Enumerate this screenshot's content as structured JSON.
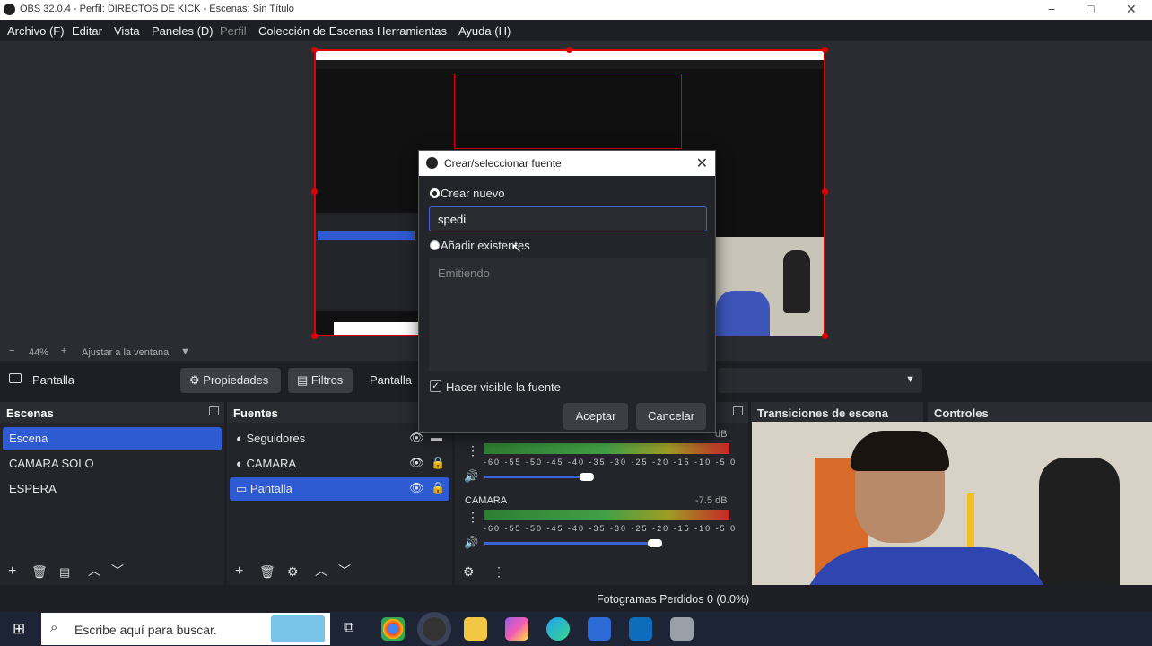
{
  "window": {
    "title": "OBS 32.0.4 - Perfil: DIRECTOS DE KICK - Escenas: Sin Título",
    "minimize": "−",
    "maximize": "□",
    "close": "✕"
  },
  "menu": [
    "Archivo (F)",
    "Editar",
    "Vista",
    "Paneles (D)",
    "Perfil",
    "Colección de Escenas",
    "Herramientas",
    "Ayuda (H)"
  ],
  "zoom": {
    "minus": "−",
    "value": "44%",
    "plus": "+",
    "fit": "Ajustar a la ventana"
  },
  "source_toolbar": {
    "source": "Pantalla",
    "properties": "Propiedades",
    "filters": "Filtros",
    "label": "Pantalla"
  },
  "scenes": {
    "title": "Escenas",
    "items": [
      "Escena",
      "CAMARA SOLO",
      "ESPERA"
    ],
    "selected": 0
  },
  "sources": {
    "title": "Fuentes",
    "items": [
      "Seguidores",
      "CAMARA",
      "Pantalla"
    ],
    "selected": 2
  },
  "mixer": {
    "tracks": [
      {
        "name": "",
        "db": "dB",
        "level": 0.5,
        "volume": 0.88
      },
      {
        "name": "CAMARA",
        "db": "-7.5 dB",
        "level": 0.5,
        "volume": 0.96
      }
    ],
    "scale": [
      "-60",
      "-55",
      "-50",
      "-45",
      "-40",
      "-35",
      "-30",
      "-25",
      "-20",
      "-15",
      "-10",
      "-5",
      "0"
    ]
  },
  "transitions": {
    "title": "Transiciones de escena"
  },
  "controls": {
    "title": "Controles"
  },
  "status": {
    "frames": "Fotogramas Perdidos 0 (0.0%)"
  },
  "dialog": {
    "title": "Crear/seleccionar fuente",
    "create_new": "Crear nuevo",
    "name_value": "spedi",
    "add_existing": "Añadir existentes",
    "existing_item": "Emitiendo",
    "visible_label": "Hacer visible la fuente",
    "visible_checked": true,
    "accept": "Aceptar",
    "cancel": "Cancelar"
  },
  "taskbar": {
    "search_placeholder": "Escribe aquí para buscar."
  },
  "colors": {
    "accent": "#2f5bd2",
    "preview_border": "#e00000",
    "taskbar": "#1d2436"
  }
}
